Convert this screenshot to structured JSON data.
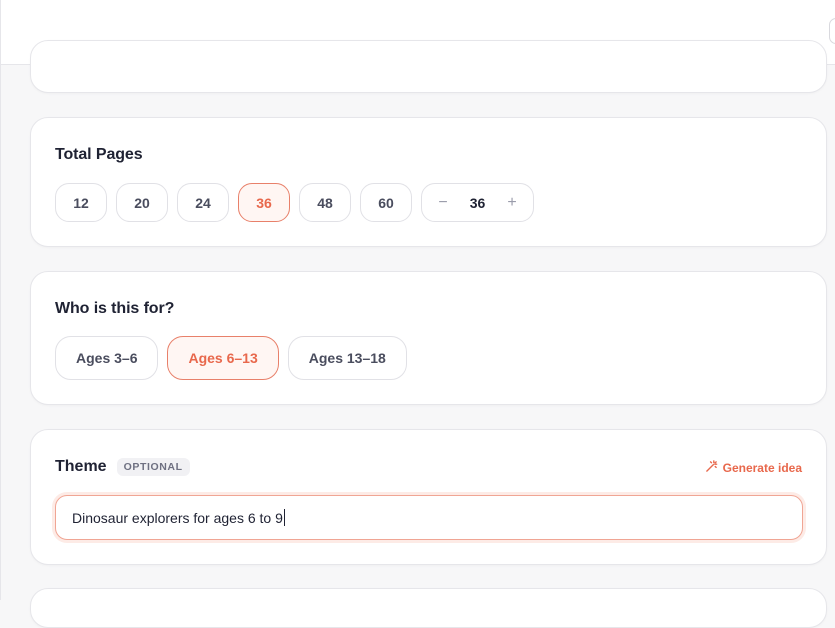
{
  "colors": {
    "accent": "#e8684c",
    "accent_border": "#e8806a",
    "accent_bg": "#fff6f3",
    "text_dark": "#1f2233",
    "border": "#e1e1e6"
  },
  "total_pages": {
    "title": "Total Pages",
    "options": [
      "12",
      "20",
      "24",
      "36",
      "48",
      "60"
    ],
    "selected": "36",
    "stepper": {
      "decrement": "−",
      "value": "36",
      "increment": "+"
    }
  },
  "audience": {
    "title": "Who is this for?",
    "options": [
      "Ages 3–6",
      "Ages 6–13",
      "Ages 13–18"
    ],
    "selected": "Ages 6–13"
  },
  "theme": {
    "title": "Theme",
    "badge": "OPTIONAL",
    "generate_label": "Generate idea",
    "generate_icon": "magic-wand-icon",
    "value": "Dinosaur explorers for ages 6 to 9"
  }
}
